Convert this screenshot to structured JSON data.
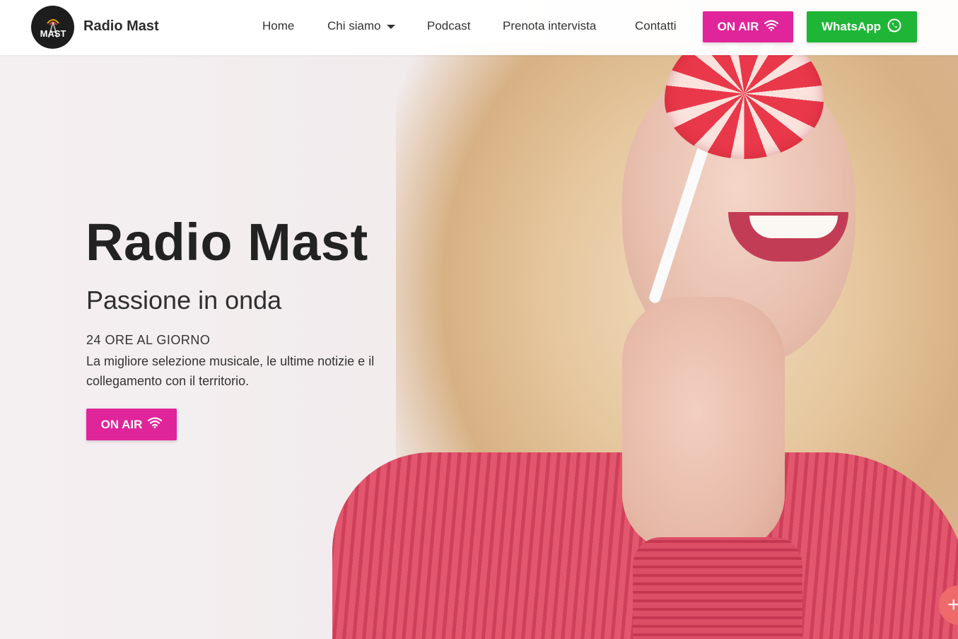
{
  "header": {
    "brand": "Radio Mast",
    "logo_text": "MAST",
    "nav": [
      {
        "label": "Home"
      },
      {
        "label": "Chi siamo"
      },
      {
        "label": "Podcast"
      },
      {
        "label": "Prenota intervista"
      },
      {
        "label": "Contatti"
      }
    ],
    "onair_label": "ON AIR",
    "whatsapp_label": "WhatsApp"
  },
  "hero": {
    "title": "Radio Mast",
    "subtitle": "Passione in onda",
    "eyebrow": "24 ORE AL GIORNO",
    "description": "La migliore selezione musicale, le ultime notizie e il collegamento con il territorio.",
    "cta_label": "ON AIR"
  },
  "icons": {
    "onair": "wifi-icon",
    "whatsapp": "whatsapp-icon",
    "fab": "plus-icon"
  },
  "colors": {
    "accent_pink": "#e0249a",
    "whatsapp_green": "#1fb536"
  }
}
